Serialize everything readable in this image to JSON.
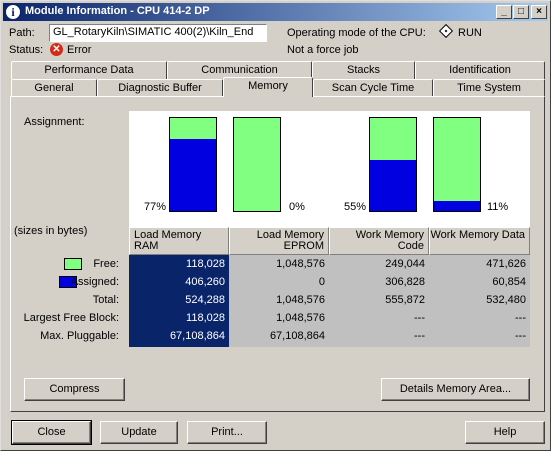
{
  "window": {
    "title": "Module Information - CPU 414-2 DP",
    "minimize": "_",
    "maximize": "□",
    "close": "×"
  },
  "header": {
    "path_label": "Path:",
    "path_value": "GL_RotaryKiln\\SIMATIC 400(2)\\Kiln_End",
    "status_label": "Status:",
    "status_value": "Error",
    "opmode_label": "Operating mode of the  CPU:",
    "opmode_value": "RUN",
    "force_text": "Not a force job"
  },
  "tabs": {
    "row1": [
      "Performance Data",
      "Communication",
      "Stacks",
      "Identification"
    ],
    "row2": [
      "General",
      "Diagnostic Buffer",
      "Memory",
      "Scan Cycle Time",
      "Time System"
    ],
    "active": "Memory"
  },
  "memory": {
    "assignment_label": "Assignment:",
    "sizes_label": "(sizes in bytes)",
    "colors": {
      "free": "#80ff80",
      "assigned": "#0000e0",
      "selected_col": "#0a246a"
    },
    "bars": [
      {
        "used_fraction": 0.77,
        "pct_label": "77%"
      },
      {
        "used_fraction": 0.0,
        "pct_label": "0%"
      },
      {
        "used_fraction": 0.55,
        "pct_label": "55%"
      },
      {
        "used_fraction": 0.11,
        "pct_label": "11%"
      }
    ],
    "columns": [
      {
        "line1": "Load Memory RAM",
        "line2": ""
      },
      {
        "line1": "Load Memory",
        "line2": "EPROM"
      },
      {
        "line1": "Work Memory",
        "line2": "Code"
      },
      {
        "line1": "Work Memory Data",
        "line2": ""
      }
    ],
    "rows": [
      {
        "label": "Free:",
        "values": [
          "118,028",
          "1,048,576",
          "249,044",
          "471,626"
        ]
      },
      {
        "label": "Assigned:",
        "values": [
          "406,260",
          "0",
          "306,828",
          "60,854"
        ]
      },
      {
        "label": "Total:",
        "values": [
          "524,288",
          "1,048,576",
          "555,872",
          "532,480"
        ]
      },
      {
        "label": "Largest Free Block:",
        "values": [
          "118,028",
          "1,048,576",
          "---",
          "---"
        ]
      },
      {
        "label": "Max. Pluggable:",
        "values": [
          "67,108,864",
          "67,108,864",
          "---",
          "---"
        ]
      }
    ]
  },
  "buttons": {
    "compress": "Compress",
    "details": "Details Memory Area...",
    "close": "Close",
    "update": "Update",
    "print": "Print...",
    "help": "Help"
  }
}
